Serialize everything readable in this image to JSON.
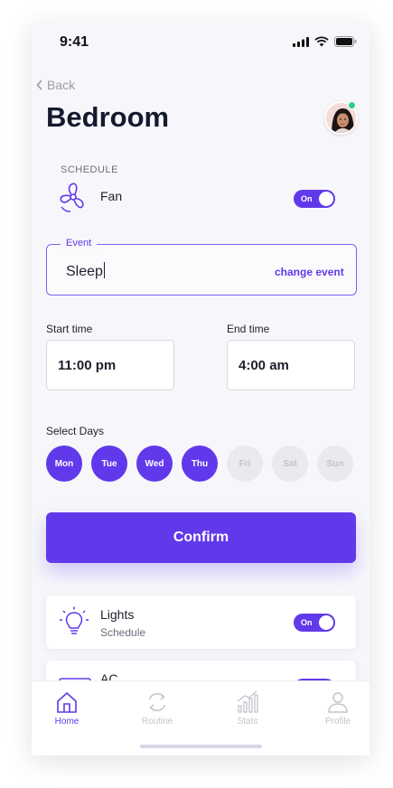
{
  "status": {
    "time": "9:41"
  },
  "nav": {
    "back_label": "Back"
  },
  "page": {
    "title": "Bedroom"
  },
  "schedule": {
    "section_label": "SCHEDULE",
    "device_name": "Fan",
    "toggle_label": "On"
  },
  "event": {
    "label": "Event",
    "value": "Sleep",
    "action_label": "change event"
  },
  "times": {
    "start_label": "Start time",
    "start_value": "11:00 pm",
    "end_label": "End time",
    "end_value": "4:00 am"
  },
  "days": {
    "label": "Select Days",
    "items": [
      {
        "label": "Mon",
        "selected": true
      },
      {
        "label": "Tue",
        "selected": true
      },
      {
        "label": "Wed",
        "selected": true
      },
      {
        "label": "Thu",
        "selected": true
      },
      {
        "label": "Fri",
        "selected": false
      },
      {
        "label": "Sat",
        "selected": false
      },
      {
        "label": "Sun",
        "selected": false
      }
    ]
  },
  "confirm_label": "Confirm",
  "devices": [
    {
      "name": "Lights",
      "subtitle": "Schedule",
      "toggle_label": "On"
    },
    {
      "name": "AC"
    }
  ],
  "tabs": [
    {
      "label": "Home",
      "icon": "home-icon",
      "active": true
    },
    {
      "label": "Routine",
      "icon": "refresh-icon",
      "active": false
    },
    {
      "label": "Stats",
      "icon": "chart-icon",
      "active": false
    },
    {
      "label": "Profile",
      "icon": "user-icon",
      "active": false
    }
  ],
  "colors": {
    "accent": "#6139ea",
    "inactive": "#c3c3cb",
    "status_online": "#2ecc8f"
  }
}
